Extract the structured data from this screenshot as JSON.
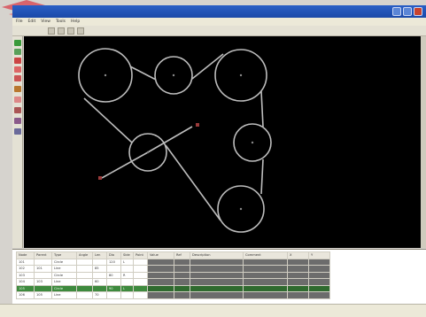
{
  "app": {
    "title": "",
    "menu": [
      "File",
      "Edit",
      "View",
      "Tools",
      "Help"
    ]
  },
  "viewport": {
    "caption": "",
    "background": "#000000",
    "stroke_color": "#bdbdbd"
  },
  "grid": {
    "headers": [
      "Node",
      "Parent",
      "Type",
      "Angle",
      "Len",
      "Dia",
      "Side",
      "Point",
      "Value",
      "Ref",
      "Description",
      "Comment",
      "X",
      "Y"
    ],
    "rows": [
      [
        "101",
        "",
        "Circle",
        "",
        "",
        "120",
        "L",
        "",
        "",
        "",
        "",
        "",
        "",
        ""
      ],
      [
        "102",
        "101",
        "Line",
        "",
        "85",
        "",
        "",
        "",
        "",
        "",
        "",
        "",
        "",
        ""
      ],
      [
        "103",
        "",
        "Circle",
        "",
        "",
        "80",
        "R",
        "",
        "",
        "",
        "",
        "",
        "",
        ""
      ],
      [
        "104",
        "103",
        "Line",
        "",
        "60",
        "",
        "",
        "",
        "",
        "",
        "",
        "",
        "",
        ""
      ],
      [
        "105",
        "",
        "Circle",
        "",
        "",
        "90",
        "L",
        "",
        "",
        "",
        "",
        "",
        "",
        ""
      ],
      [
        "106",
        "105",
        "Line",
        "",
        "70",
        "",
        "",
        "",
        "",
        "",
        "",
        "",
        "",
        ""
      ]
    ],
    "selected_row": 4
  },
  "status": {
    "text": ""
  }
}
